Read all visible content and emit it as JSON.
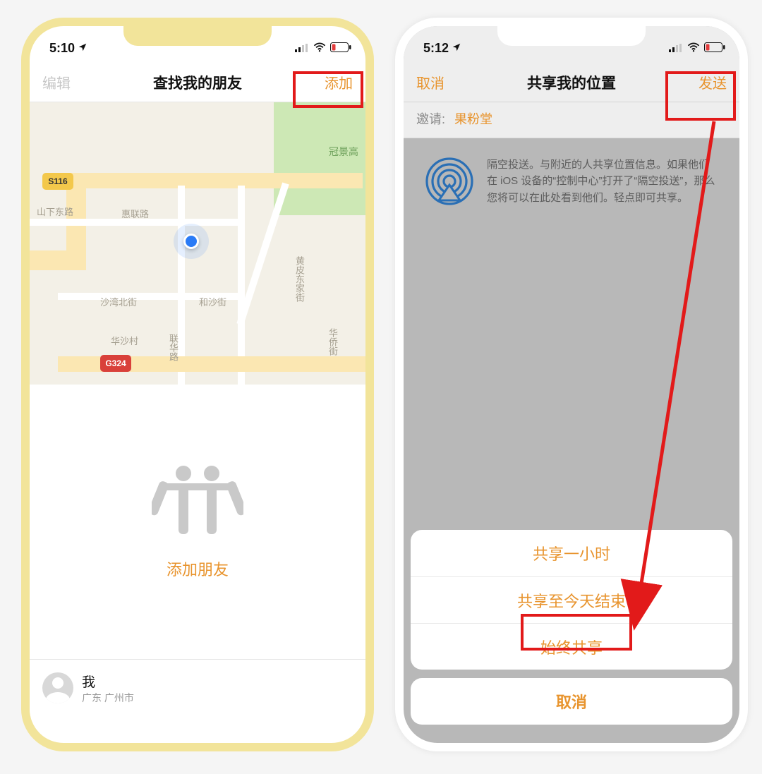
{
  "left": {
    "status_time": "5:10",
    "nav_left": "编辑",
    "nav_title": "查找我的朋友",
    "nav_right": "添加",
    "map": {
      "park_label": "冠景高",
      "roads": {
        "shanxia": "山下东路",
        "huilian": "惠联路",
        "shawanbei": "沙湾北街",
        "hesha": "和沙街",
        "huasha": "华沙村",
        "lianhua": "联华路",
        "huangpi": "黄皮东家街",
        "huaqiao": "华侨街"
      },
      "shields": {
        "s116": "S116",
        "g324": "G324"
      }
    },
    "empty_label": "添加朋友",
    "me": {
      "name": "我",
      "location": "广东 广州市"
    }
  },
  "right": {
    "status_time": "5:12",
    "nav_left": "取消",
    "nav_title": "共享我的位置",
    "nav_right": "发送",
    "invite_label": "邀请:",
    "invite_value": "果粉堂",
    "airdrop_text": "隔空投送。与附近的人共享位置信息。如果他们在 iOS 设备的“控制中心”打开了“隔空投送”，那么您将可以在此处看到他们。轻点即可共享。",
    "sheet": {
      "opt1": "共享一小时",
      "opt2": "共享至今天结束",
      "opt3": "始终共享",
      "cancel": "取消"
    }
  }
}
